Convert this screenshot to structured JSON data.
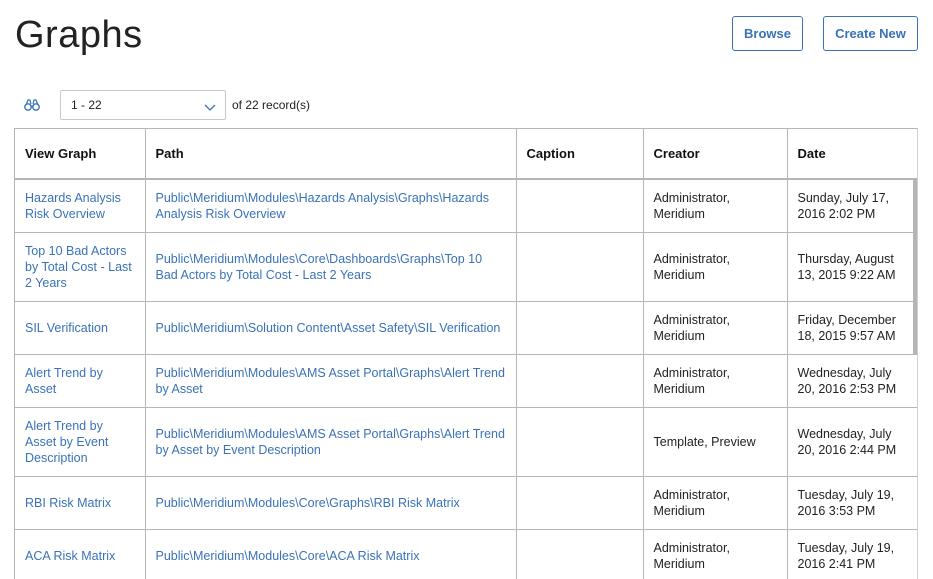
{
  "header": {
    "title": "Graphs",
    "browse_label": "Browse",
    "create_label": "Create New"
  },
  "pager": {
    "range": "1 - 22",
    "of_label": "of 22 record(s)"
  },
  "table": {
    "columns": [
      "View Graph",
      "Path",
      "Caption",
      "Creator",
      "Date"
    ],
    "rows": [
      {
        "view": "Hazards Analysis Risk Overview",
        "path": "Public\\Meridium\\Modules\\Hazards Analysis\\Graphs\\Hazards Analysis Risk Overview",
        "caption": "",
        "creator": "Administrator, Meridium",
        "date": "Sunday, July 17, 2016 2:02 PM"
      },
      {
        "view": "Top 10 Bad Actors by Total Cost - Last 2 Years",
        "path": "Public\\Meridium\\Modules\\Core\\Dashboards\\Graphs\\Top 10 Bad Actors by Total Cost - Last 2 Years",
        "caption": "",
        "creator": "Administrator, Meridium",
        "date": "Thursday, August 13, 2015 9:22 AM"
      },
      {
        "view": "SIL Verification",
        "path": "Public\\Meridium\\Solution Content\\Asset Safety\\SIL Verification",
        "caption": "",
        "creator": "Administrator, Meridium",
        "date": "Friday, December 18, 2015 9:57 AM"
      },
      {
        "view": "Alert Trend by Asset",
        "path": "Public\\Meridium\\Modules\\AMS Asset Portal\\Graphs\\Alert Trend by Asset",
        "caption": "",
        "creator": "Administrator, Meridium",
        "date": "Wednesday, July 20, 2016 2:53 PM"
      },
      {
        "view": "Alert Trend by Asset by Event Description",
        "path": "Public\\Meridium\\Modules\\AMS Asset Portal\\Graphs\\Alert Trend by Asset by Event Description",
        "caption": "",
        "creator": "Template, Preview",
        "date": "Wednesday, July 20, 2016 2:44 PM"
      },
      {
        "view": "RBI Risk Matrix",
        "path": "Public\\Meridium\\Modules\\Core\\Graphs\\RBI Risk Matrix",
        "caption": "",
        "creator": "Administrator, Meridium",
        "date": "Tuesday, July 19, 2016 3:53 PM"
      },
      {
        "view": "ACA Risk Matrix",
        "path": "Public\\Meridium\\Modules\\Core\\ACA Risk Matrix",
        "caption": "",
        "creator": "Administrator, Meridium",
        "date": "Tuesday, July 19, 2016 2:41 PM"
      }
    ]
  },
  "icons": {
    "search": "binoculars-icon",
    "dropdown": "chevron-down-icon"
  },
  "colors": {
    "accent": "#3a72b8",
    "border": "#b5b5b5"
  }
}
